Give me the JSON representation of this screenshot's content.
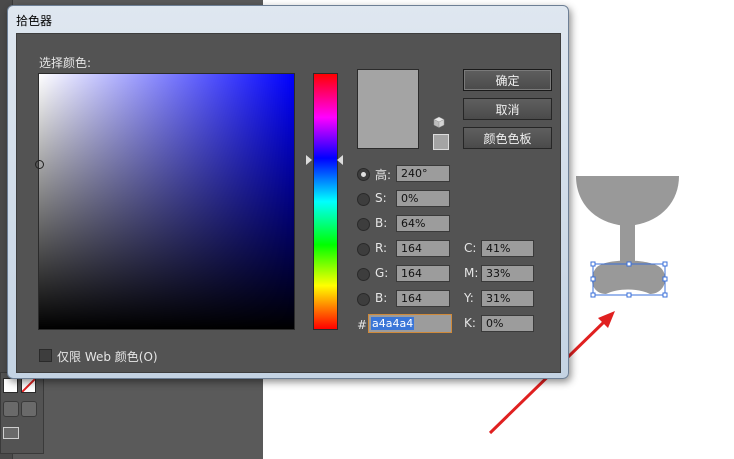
{
  "dialog": {
    "title": "拾色器",
    "select_color_label": "选择颜色:",
    "buttons": {
      "ok": "确定",
      "cancel": "取消",
      "swatches": "颜色色板"
    },
    "fields": {
      "h": {
        "label": "高:",
        "value": "240°",
        "selected": true
      },
      "s": {
        "label": "S:",
        "value": "0%"
      },
      "b": {
        "label": "B:",
        "value": "64%"
      },
      "r": {
        "label": "R:",
        "value": "164"
      },
      "g": {
        "label": "G:",
        "value": "164"
      },
      "blue": {
        "label": "B:",
        "value": "164"
      }
    },
    "cmyk": {
      "c": {
        "label": "C:",
        "value": "41%"
      },
      "m": {
        "label": "M:",
        "value": "33%"
      },
      "y": {
        "label": "Y:",
        "value": "31%"
      },
      "k": {
        "label": "K:",
        "value": "0%"
      }
    },
    "hex": {
      "label": "#",
      "value": "a4a4a4"
    },
    "web_only_label": "仅限 Web 颜色(O)"
  },
  "colors": {
    "selected": "#a4a4a4",
    "hue_base": "#0000ff",
    "artwork_fill": "#999999",
    "annotation_arrow": "#e02020",
    "selection": "#3a6fd8"
  },
  "icons": [
    "gamut-cube-icon",
    "annotation-arrow",
    "goblet-artwork"
  ]
}
